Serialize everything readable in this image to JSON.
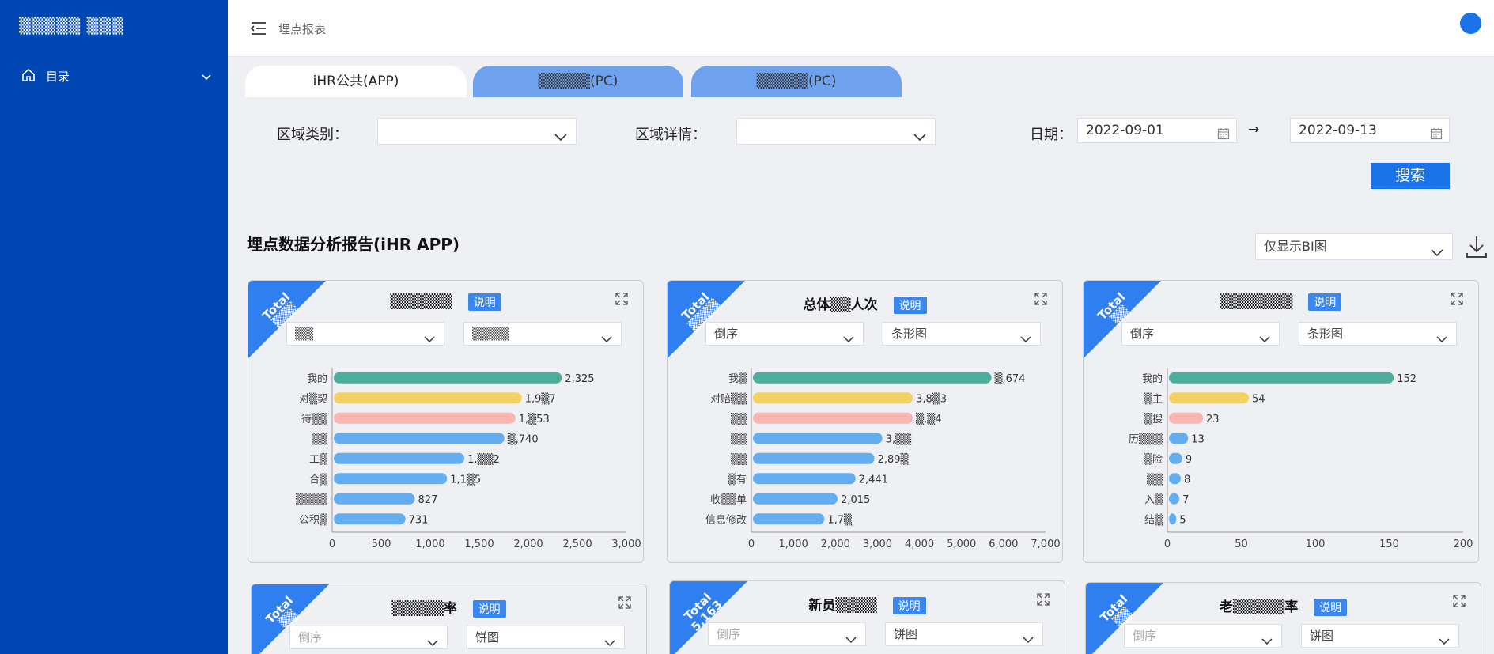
{
  "sidebar": {
    "brand": "▒▒▒▒▒ ▒▒▒",
    "menu_label": "目录"
  },
  "header": {
    "breadcrumb": "埋点报表"
  },
  "tabs": [
    "iHR公共(APP)",
    "▒▒▒▒▒(PC)",
    "▒▒▒▒▒(PC)"
  ],
  "filters": {
    "region_type_label": "区域类别：",
    "region_type_value": "",
    "region_detail_label": "区域详情：",
    "region_detail_value": "",
    "date_label": "日期：",
    "date_start": "2022-09-01",
    "date_arrow": "→",
    "date_end": "2022-09-13",
    "search_label": "搜索"
  },
  "section": {
    "title": "埋点数据分析报告(iHR APP)",
    "view_select": "仅显示BI图"
  },
  "colors": {
    "teal": "#4cae9a",
    "yellow": "#f5d163",
    "pink": "#f9b5b0",
    "blue": "#64aef0",
    "accent": "#1a73e8",
    "sidebar": "#0047b3"
  },
  "cards": [
    {
      "ribbon": "Total",
      "ribbon_value": "▒▒▒",
      "title": "▒▒▒▒▒▒",
      "badge": "说明",
      "sort": "▒▒",
      "chart_type_label": "▒▒▒▒"
    },
    {
      "ribbon": "Total",
      "ribbon_value": "▒▒▒▒",
      "title": "总体▒▒人次",
      "badge": "说明",
      "sort": "倒序",
      "chart_type_label": "条形图"
    },
    {
      "ribbon": "Total",
      "ribbon_value": "▒▒",
      "title": "▒▒▒▒▒▒▒",
      "badge": "说明",
      "sort": "倒序",
      "chart_type_label": "条形图"
    },
    {
      "ribbon": "Total",
      "ribbon_value": "▒▒",
      "title": "▒▒▒▒▒率",
      "badge": "说明",
      "sort": "倒序",
      "chart_type_label": "饼图"
    },
    {
      "ribbon": "Total",
      "ribbon_value": "5,163",
      "title": "新员▒▒▒▒",
      "badge": "说明",
      "sort": "倒序",
      "chart_type_label": "饼图"
    },
    {
      "ribbon": "Total",
      "ribbon_value": "▒▒",
      "title": "老▒▒▒▒▒率",
      "badge": "说明",
      "sort": "倒序",
      "chart_type_label": "饼图"
    }
  ],
  "chart_data": [
    {
      "type": "bar",
      "orientation": "horizontal",
      "categories": [
        "我的",
        "对▒契",
        "待▒▒",
        "▒▒",
        "工▒",
        "合▒",
        "▒▒▒▒",
        "公积▒"
      ],
      "values": [
        2325,
        1917,
        1853,
        1740,
        1332,
        1155,
        827,
        731
      ],
      "value_labels": [
        "2,325",
        "1,9▒7",
        "1,▒53",
        "▒,740",
        "1,▒▒2",
        "1,1▒5",
        "827",
        "731"
      ],
      "xlim": [
        0,
        3000
      ],
      "xticks": [
        "0",
        "500",
        "1,000",
        "1,500",
        "2,000",
        "2,500",
        "3,000"
      ]
    },
    {
      "type": "bar",
      "orientation": "horizontal",
      "categories": [
        "我▒",
        "对赔▒▒",
        "▒▒",
        "▒▒",
        "▒▒",
        "▒有",
        "收▒▒单",
        "信息修改"
      ],
      "values": [
        5674,
        3803,
        3804,
        3080,
        2890,
        2441,
        2015,
        1700
      ],
      "value_labels": [
        "▒,674",
        "3,8▒3",
        "▒,▒4",
        "3,▒▒",
        "2,89▒",
        "2,441",
        "2,015",
        "1,7▒"
      ],
      "xlim": [
        0,
        7000
      ],
      "xticks": [
        "0",
        "1,000",
        "2,000",
        "3,000",
        "4,000",
        "5,000",
        "6,000",
        "7,000"
      ]
    },
    {
      "type": "bar",
      "orientation": "horizontal",
      "categories": [
        "我的",
        "▒主",
        "▒搜",
        "历▒▒▒",
        "▒险",
        "▒▒",
        "入▒",
        "结▒"
      ],
      "values": [
        152,
        54,
        23,
        13,
        9,
        8,
        7,
        5
      ],
      "value_labels": [
        "152",
        "54",
        "23",
        "13",
        "9",
        "8",
        "7",
        "5"
      ],
      "xlim": [
        0,
        200
      ],
      "xticks": [
        "0",
        "50",
        "100",
        "150",
        "200"
      ]
    }
  ]
}
